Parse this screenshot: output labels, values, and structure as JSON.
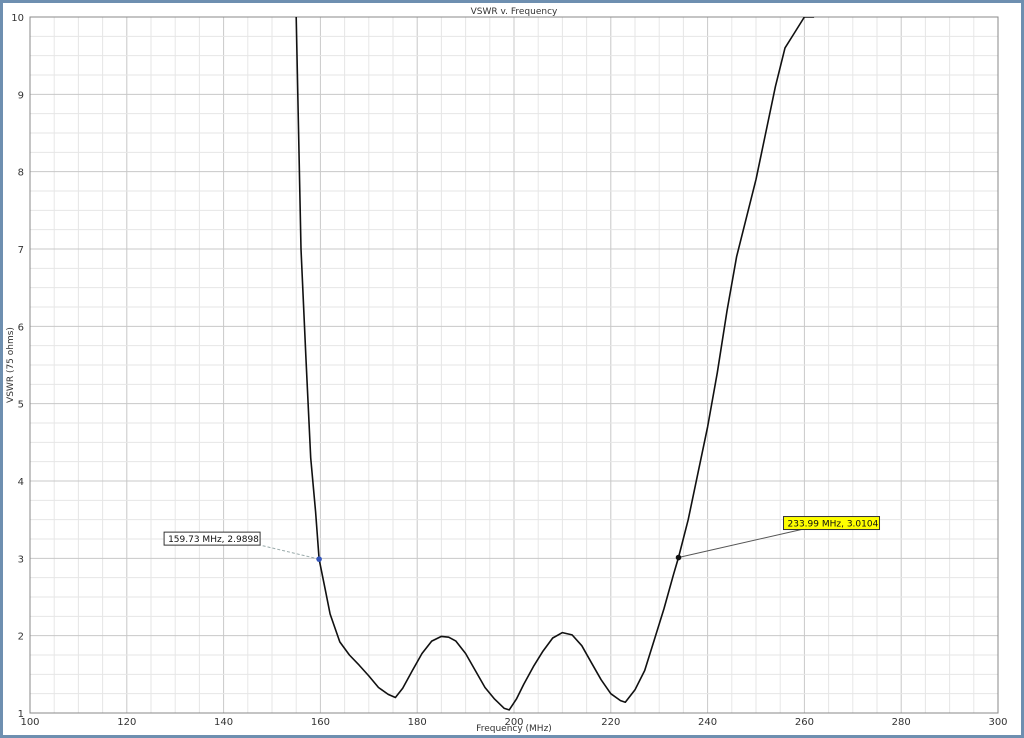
{
  "chart_data": {
    "type": "line",
    "title": "VSWR v. Frequency",
    "xlabel": "Frequency (MHz)",
    "ylabel": "VSWR (75 ohms)",
    "xlim": [
      100,
      300
    ],
    "ylim": [
      1,
      10
    ],
    "xticks": [
      100,
      120,
      140,
      160,
      180,
      200,
      220,
      240,
      260,
      280,
      300
    ],
    "yticks": [
      1,
      2,
      3,
      4,
      5,
      6,
      7,
      8,
      9,
      10
    ],
    "grid": true,
    "series": [
      {
        "color": "#111111",
        "x": [
          155.0,
          156.0,
          157.0,
          158.0,
          159.0,
          159.73,
          161.0,
          162.0,
          164.0,
          166.0,
          168.0,
          170.0,
          172.0,
          174.0,
          175.5,
          177.0,
          179.0,
          181.0,
          183.0,
          185.0,
          186.5,
          188.0,
          190.0,
          192.0,
          194.0,
          196.0,
          198.0,
          199.0,
          200.5,
          202.0,
          204.0,
          206.0,
          208.0,
          210.0,
          212.0,
          214.0,
          216.0,
          218.0,
          220.0,
          222.0,
          223.0,
          225.0,
          227.0,
          229.0,
          231.0,
          233.0,
          233.99,
          236.0,
          238.0,
          240.0,
          242.0,
          244.0,
          246.0,
          248.0,
          250.0,
          252.0,
          254.0,
          256.0,
          258.0,
          260.0,
          262.0
        ],
        "y": [
          10.0,
          7.0,
          5.6,
          4.3,
          3.6,
          2.9898,
          2.6,
          2.28,
          1.92,
          1.75,
          1.62,
          1.48,
          1.33,
          1.24,
          1.2,
          1.32,
          1.55,
          1.77,
          1.93,
          1.99,
          1.98,
          1.93,
          1.77,
          1.55,
          1.33,
          1.18,
          1.06,
          1.04,
          1.18,
          1.37,
          1.6,
          1.8,
          1.97,
          2.04,
          2.01,
          1.87,
          1.65,
          1.43,
          1.25,
          1.16,
          1.14,
          1.3,
          1.55,
          1.95,
          2.35,
          2.8,
          3.0104,
          3.5,
          4.1,
          4.7,
          5.4,
          6.2,
          6.9,
          7.4,
          7.9,
          8.5,
          9.1,
          9.6,
          9.8,
          10.0,
          10.0
        ]
      }
    ],
    "markers": [
      {
        "x": 159.73,
        "y": 2.9898,
        "label": "159.73 MHz, 2.9898",
        "color": "#3355bb",
        "box_fill": "#ffffff",
        "leader": "dashed"
      },
      {
        "x": 233.99,
        "y": 3.0104,
        "label": "233.99 MHz, 3.0104",
        "color": "#111111",
        "box_fill": "#ffff00",
        "leader": "solid"
      }
    ]
  },
  "colors": {
    "frame": "#6e8fb0",
    "grid_major": "#c8c8c8",
    "grid_minor": "#e6e6e6",
    "axis": "#888888"
  }
}
